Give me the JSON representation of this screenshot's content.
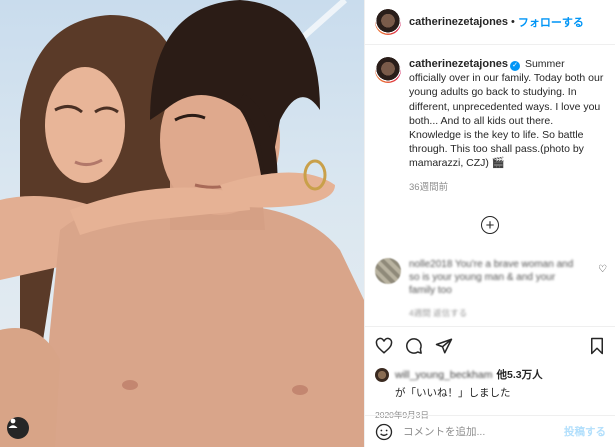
{
  "post": {
    "username": "catherinezetajones",
    "follow_label": "フォローする",
    "separator": "•",
    "caption": "Summer officially over in our family. Today both our young adults go back to studying. In different, unprecedented ways. I love you both... And to all kids out there. Knowledge is the key to life. So battle through. This too shall pass.(photo by mamarazzi, CZJ) 🎬",
    "time_ago": "36週間前",
    "verified_glyph": "✓"
  },
  "comment": {
    "text": "nolle2018 You're a brave woman and so is your young man & and your family too",
    "meta": "4週間  返信する"
  },
  "likes": {
    "liked_by": "will_young_beckham",
    "others": "他5.3万人",
    "suffix": "が「いいね！」しました",
    "date": "2020年9月3日"
  },
  "add_comment": {
    "placeholder": "コメントを追加...",
    "post_label": "投稿する"
  },
  "icons": {
    "avatar": "profile-avatar-icon",
    "heart": "heart-icon",
    "comment": "comment-icon",
    "share": "share-icon",
    "bookmark": "bookmark-icon",
    "plus": "plus-circle-icon",
    "emoji": "emoji-icon",
    "user": "user-tag-icon"
  },
  "colors": {
    "accent": "#0095f6",
    "post_disabled": "#b2dffc",
    "muted": "#8e8e8e"
  }
}
